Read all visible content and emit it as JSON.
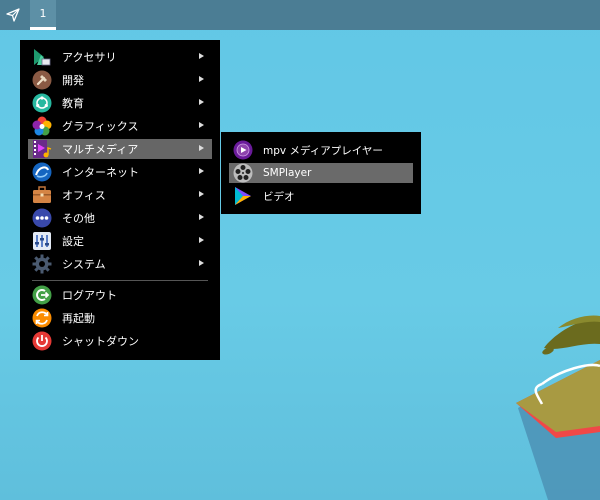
{
  "taskbar": {
    "workspace_label": "1"
  },
  "main_menu": {
    "items": [
      {
        "label": "アクセサリ",
        "icon": "accessories-icon",
        "submenu": true
      },
      {
        "label": "開発",
        "icon": "development-icon",
        "submenu": true
      },
      {
        "label": "教育",
        "icon": "education-icon",
        "submenu": true
      },
      {
        "label": "グラフィックス",
        "icon": "graphics-icon",
        "submenu": true
      },
      {
        "label": "マルチメディア",
        "icon": "multimedia-icon",
        "submenu": true,
        "active": true
      },
      {
        "label": "インターネット",
        "icon": "internet-icon",
        "submenu": true
      },
      {
        "label": "オフィス",
        "icon": "office-icon",
        "submenu": true
      },
      {
        "label": "その他",
        "icon": "other-icon",
        "submenu": true
      },
      {
        "label": "設定",
        "icon": "settings-icon",
        "submenu": true
      },
      {
        "label": "システム",
        "icon": "system-icon",
        "submenu": true
      }
    ],
    "session_items": [
      {
        "label": "ログアウト",
        "icon": "logout-icon"
      },
      {
        "label": "再起動",
        "icon": "reboot-icon"
      },
      {
        "label": "シャットダウン",
        "icon": "shutdown-icon"
      }
    ]
  },
  "submenu": {
    "items": [
      {
        "label": "mpv メディアプレイヤー",
        "icon": "mpv-icon"
      },
      {
        "label": "SMPlayer",
        "icon": "smplayer-icon",
        "active": true
      },
      {
        "label": "ビデオ",
        "icon": "video-icon"
      }
    ]
  },
  "colors": {
    "desktop": "#62c7e6",
    "taskbar": "#4b7d94",
    "menu_bg": "#000000",
    "highlight": "#666666"
  }
}
